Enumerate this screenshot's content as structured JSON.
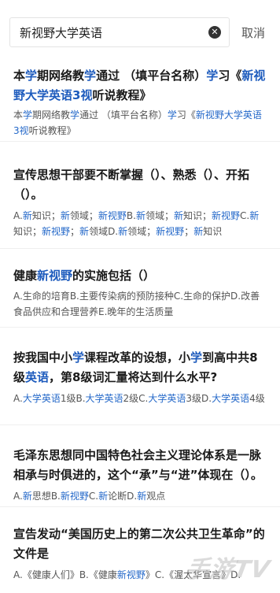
{
  "search": {
    "query": "新视野大学英语",
    "cancel_label": "取消"
  },
  "results": [
    {
      "title_parts": [
        [
          "本",
          0
        ],
        [
          "学",
          1
        ],
        [
          "期网络教",
          0
        ],
        [
          "学",
          1
        ],
        [
          "通过 （填平台名称）",
          0
        ],
        [
          "学",
          1
        ],
        [
          "习《",
          0
        ],
        [
          "新视野大学英语3视",
          1
        ],
        [
          "听说教程》",
          0
        ]
      ],
      "desc_parts": [
        [
          "本",
          0
        ],
        [
          "学",
          1
        ],
        [
          "期网络教",
          0
        ],
        [
          "学",
          1
        ],
        [
          "通过 （填平台名称）",
          0
        ],
        [
          "学",
          1
        ],
        [
          "习《",
          0
        ],
        [
          "新视野大学英语3视",
          1
        ],
        [
          "听说教程》",
          0
        ]
      ]
    },
    {
      "title_parts": [
        [
          "宣传思想干部要不断掌握（）、熟悉（）、开拓（）。",
          0
        ]
      ],
      "desc_parts": [
        [
          "A.",
          0
        ],
        [
          "新",
          1
        ],
        [
          "知识；",
          0
        ],
        [
          "新",
          1
        ],
        [
          "领域；",
          0
        ],
        [
          "新视野",
          1
        ],
        [
          "B.",
          0
        ],
        [
          "新",
          1
        ],
        [
          "领域；",
          0
        ],
        [
          "新",
          1
        ],
        [
          "知识；",
          0
        ],
        [
          "新视野",
          1
        ],
        [
          "C.",
          0
        ],
        [
          "新",
          1
        ],
        [
          "知识；",
          0
        ],
        [
          "新视野",
          1
        ],
        [
          "；",
          0
        ],
        [
          "新",
          1
        ],
        [
          "领域D.",
          0
        ],
        [
          "新",
          1
        ],
        [
          "领域；",
          0
        ],
        [
          "新视野",
          1
        ],
        [
          "；",
          0
        ],
        [
          "新",
          1
        ],
        [
          "知识",
          0
        ]
      ]
    },
    {
      "title_parts": [
        [
          "健康",
          0
        ],
        [
          "新视野",
          1
        ],
        [
          "的实施包括（）",
          0
        ]
      ],
      "desc_parts": [
        [
          "A.生命的培育B.主要传染病的预防接种C.生命的保护D.改善食品供应和合理营养E.晚年的生活质量",
          0
        ]
      ]
    },
    {
      "title_parts": [
        [
          "按我国中小",
          0
        ],
        [
          "学",
          1
        ],
        [
          "课程改革的设想，小",
          0
        ],
        [
          "学",
          1
        ],
        [
          "到高中共8级",
          0
        ],
        [
          "英语",
          1
        ],
        [
          "，第8级词汇量将达到什么水平?",
          0
        ]
      ],
      "desc_parts": [
        [
          "A.",
          0
        ],
        [
          "大学英语",
          1
        ],
        [
          "1级B.",
          0
        ],
        [
          "大学英语",
          1
        ],
        [
          "2级C.",
          0
        ],
        [
          "大学英语",
          1
        ],
        [
          "3级D.",
          0
        ],
        [
          "大学英语",
          1
        ],
        [
          "4级",
          0
        ]
      ]
    },
    {
      "title_parts": [
        [
          "毛泽东思想同中国特色社会主义理论体系是一脉相承与时俱进的，这个“承”与“进”体现在（）。",
          0
        ]
      ],
      "desc_parts": [
        [
          "A.",
          0
        ],
        [
          "新",
          1
        ],
        [
          "思想B.",
          0
        ],
        [
          "新视野",
          1
        ],
        [
          "C.",
          0
        ],
        [
          "新",
          1
        ],
        [
          "论断D.",
          0
        ],
        [
          "新",
          1
        ],
        [
          "观点",
          0
        ]
      ]
    },
    {
      "title_parts": [
        [
          "宣告发动“美国历史上的第二次公共卫生革命”的文件是",
          0
        ]
      ],
      "desc_parts": [
        [
          "A.《健康人们》B.《健康",
          0
        ],
        [
          "新视野",
          1
        ],
        [
          "》C.《渥太华宣言》D.",
          0
        ]
      ]
    }
  ],
  "watermark": "手游TV",
  "colors": {
    "highlight": "#2468c9",
    "divider": "#efefef"
  }
}
